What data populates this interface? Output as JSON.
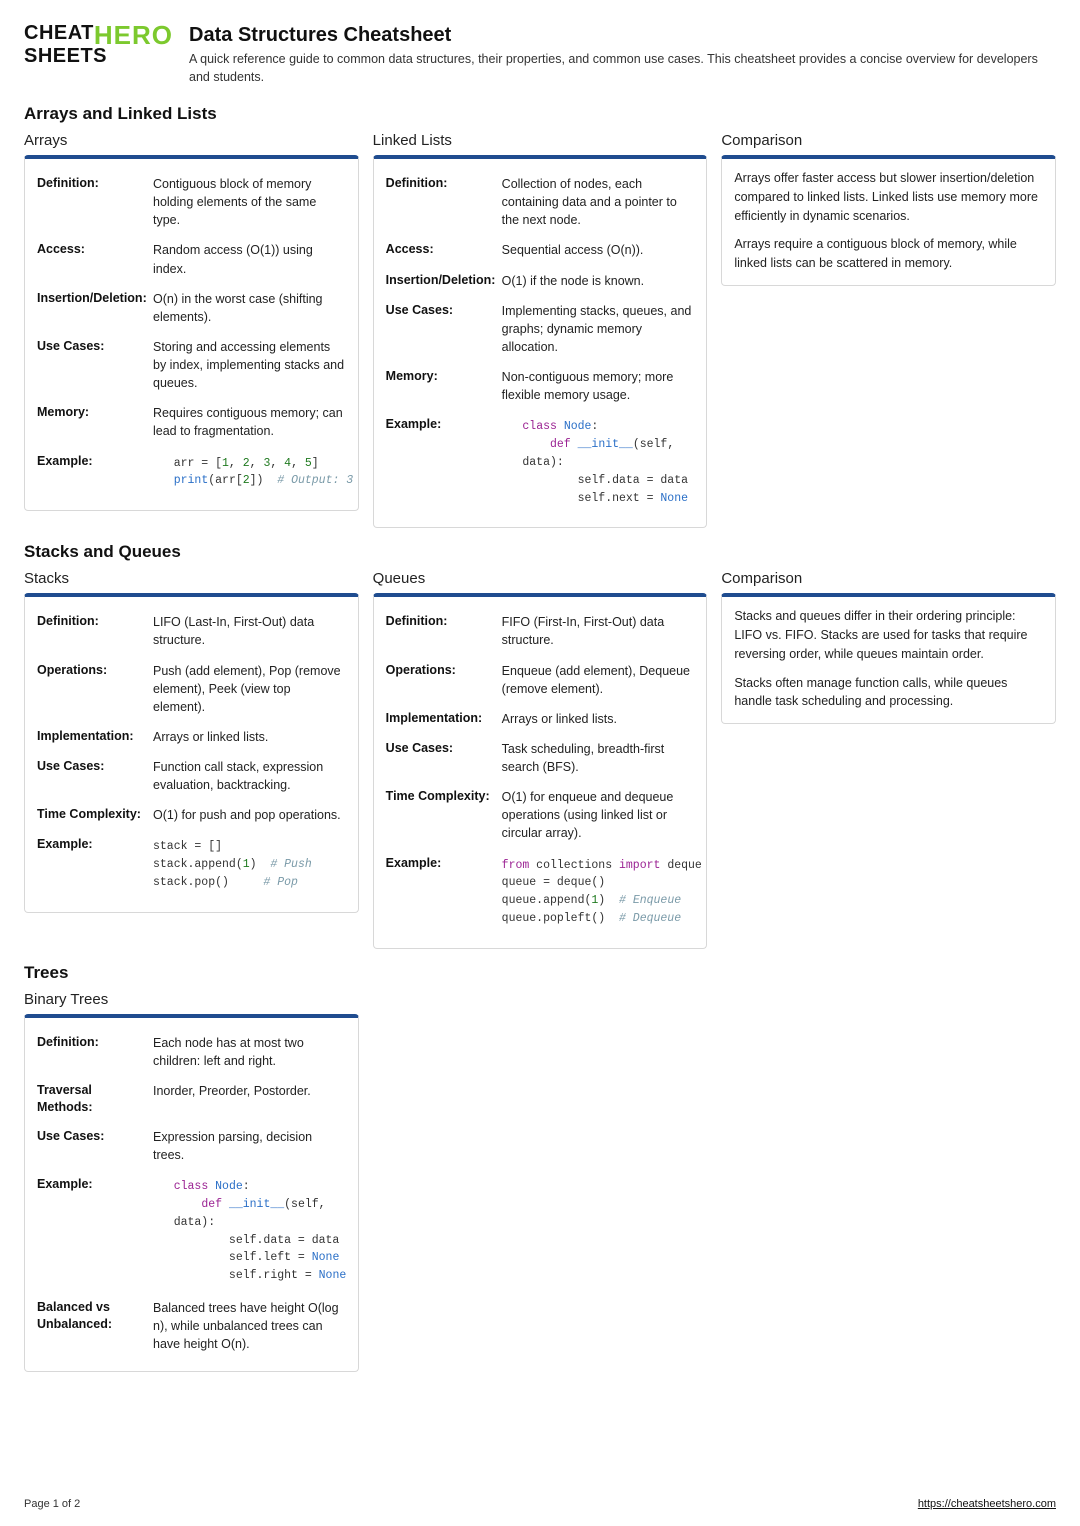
{
  "header": {
    "logo_cheat": "CHEAT",
    "logo_hero": "HERO",
    "logo_sheets": "SHEETS",
    "title": "Data Structures Cheatsheet",
    "subtitle": "A quick reference guide to common data structures, their properties, and common use cases. This cheatsheet provides a concise overview for developers and students."
  },
  "section1": {
    "heading": "Arrays and Linked Lists",
    "arrays": {
      "title": "Arrays",
      "rows": {
        "def_k": "Definition:",
        "def_v": "Contiguous block of memory holding elements of the same type.",
        "acc_k": "Access:",
        "acc_v": "Random access (O(1)) using index.",
        "ins_k": "Insertion/Deletion:",
        "ins_v": "O(n) in the worst case (shifting elements).",
        "use_k": "Use Cases:",
        "use_v": "Storing and accessing elements by index, implementing stacks and queues.",
        "mem_k": "Memory:",
        "mem_v": "Requires contiguous memory; can lead to fragmentation.",
        "ex_k": "Example:"
      }
    },
    "linked": {
      "title": "Linked Lists",
      "rows": {
        "def_k": "Definition:",
        "def_v": "Collection of nodes, each containing data and a pointer to the next node.",
        "acc_k": "Access:",
        "acc_v": "Sequential access (O(n)).",
        "ins_k": "Insertion/Deletion:",
        "ins_v": "O(1) if the node is known.",
        "use_k": "Use Cases:",
        "use_v": "Implementing stacks, queues, and graphs; dynamic memory allocation.",
        "mem_k": "Memory:",
        "mem_v": "Non-contiguous memory; more flexible memory usage.",
        "ex_k": "Example:"
      }
    },
    "compare": {
      "title": "Comparison",
      "p1": "Arrays offer faster access but slower insertion/deletion compared to linked lists. Linked lists use memory more efficiently in dynamic scenarios.",
      "p2": "Arrays require a contiguous block of memory, while linked lists can be scattered in memory."
    }
  },
  "section2": {
    "heading": "Stacks and Queues",
    "stacks": {
      "title": "Stacks",
      "rows": {
        "def_k": "Definition:",
        "def_v": "LIFO (Last-In, First-Out) data structure.",
        "op_k": "Operations:",
        "op_v": "Push (add element), Pop (remove element), Peek (view top element).",
        "imp_k": "Implementation:",
        "imp_v": "Arrays or linked lists.",
        "use_k": "Use Cases:",
        "use_v": "Function call stack, expression evaluation, backtracking.",
        "tc_k": "Time Complexity:",
        "tc_v": "O(1) for push and pop operations.",
        "ex_k": "Example:"
      }
    },
    "queues": {
      "title": "Queues",
      "rows": {
        "def_k": "Definition:",
        "def_v": "FIFO (First-In, First-Out) data structure.",
        "op_k": "Operations:",
        "op_v": "Enqueue (add element), Dequeue (remove element).",
        "imp_k": "Implementation:",
        "imp_v": "Arrays or linked lists.",
        "use_k": "Use Cases:",
        "use_v": "Task scheduling, breadth-first search (BFS).",
        "tc_k": "Time Complexity:",
        "tc_v": "O(1) for enqueue and dequeue operations (using linked list or circular array).",
        "ex_k": "Example:"
      }
    },
    "compare": {
      "title": "Comparison",
      "p1": "Stacks and queues differ in their ordering principle: LIFO vs. FIFO. Stacks are used for tasks that require reversing order, while queues maintain order.",
      "p2": "Stacks often manage function calls, while queues handle task scheduling and processing."
    }
  },
  "section3": {
    "heading": "Trees",
    "bt": {
      "title": "Binary Trees",
      "rows": {
        "def_k": "Definition:",
        "def_v": "Each node has at most two children: left and right.",
        "trav_k": "Traversal Methods:",
        "trav_v": "Inorder, Preorder, Postorder.",
        "use_k": "Use Cases:",
        "use_v": "Expression parsing, decision trees.",
        "ex_k": "Example:",
        "bal_k": "Balanced vs Unbalanced:",
        "bal_v": "Balanced trees have height O(log n), while unbalanced trees can have height O(n)."
      }
    }
  },
  "footer": {
    "page": "Page 1 of 2",
    "url": "https://cheatsheetshero.com"
  }
}
